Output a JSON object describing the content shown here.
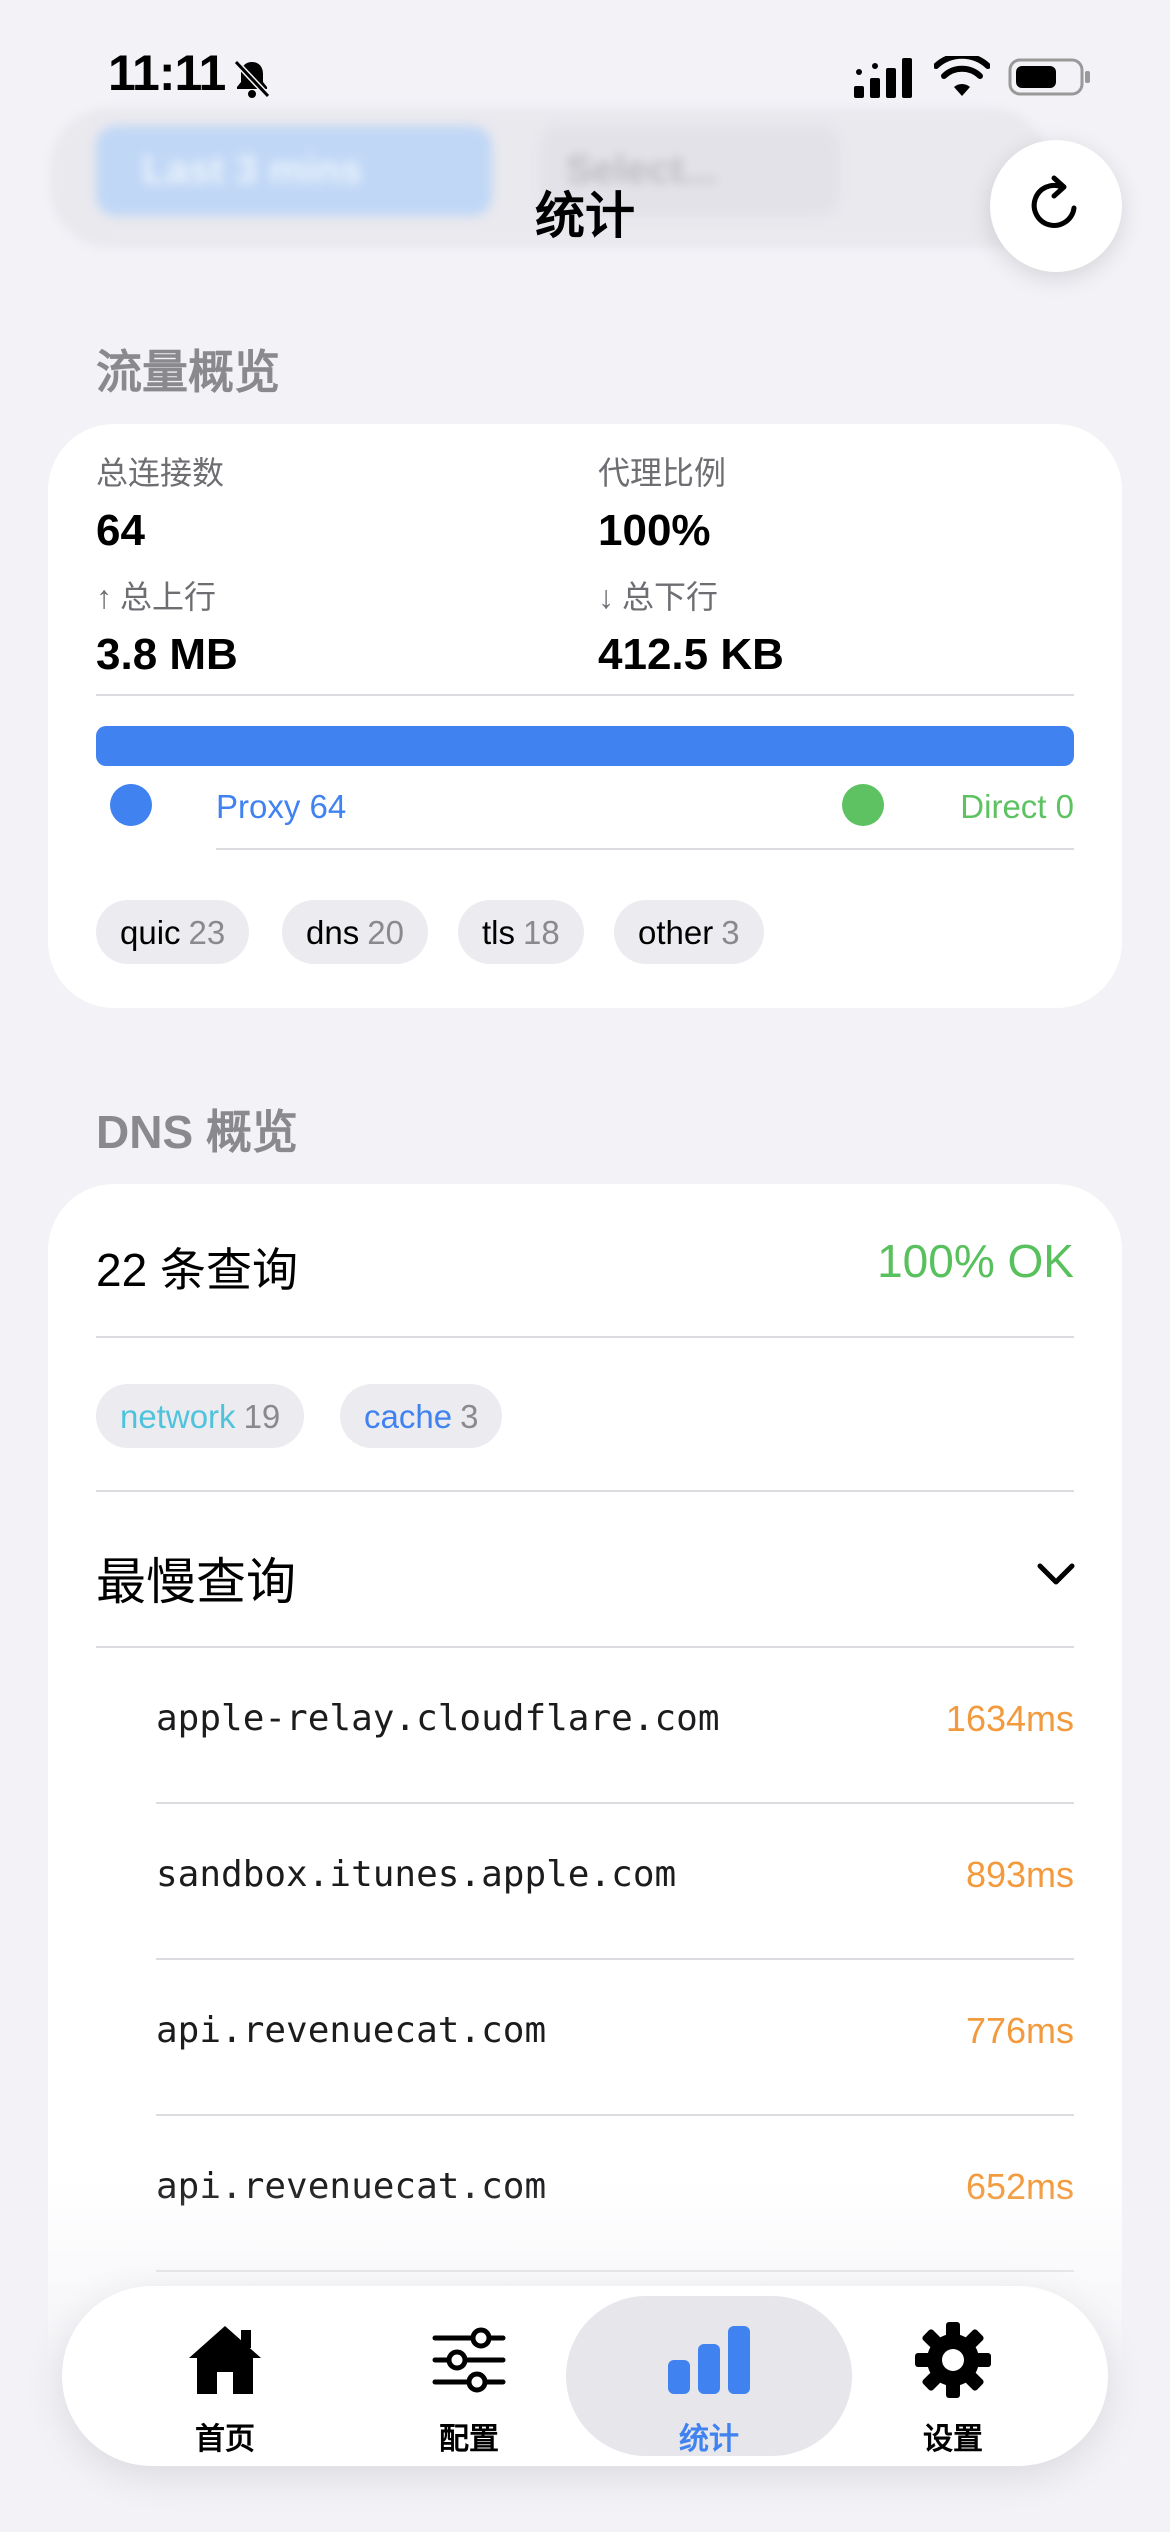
{
  "status_bar": {
    "time": "11:11"
  },
  "header": {
    "title": "统计",
    "time_filter": "Last 3 mins",
    "select_placeholder": "Select..."
  },
  "traffic": {
    "section_title": "流量概览",
    "total_connections_label": "总连接数",
    "total_connections": "64",
    "proxy_ratio_label": "代理比例",
    "proxy_ratio": "100%",
    "upload_label": "总上行",
    "upload": "3.8 MB",
    "download_label": "总下行",
    "download": "412.5 KB",
    "ratio_fraction": 1.0,
    "proxy_legend": "Proxy 64",
    "direct_legend": "Direct 0",
    "protocols": [
      {
        "name": "quic",
        "count": "23"
      },
      {
        "name": "dns",
        "count": "20"
      },
      {
        "name": "tls",
        "count": "18"
      },
      {
        "name": "other",
        "count": "3"
      }
    ],
    "colors": {
      "proxy": "#3f82f0",
      "direct": "#5ec262"
    }
  },
  "dns": {
    "section_title": "DNS 概览",
    "queries": "22 条查询",
    "ok": "100% OK",
    "sources": [
      {
        "name": "network",
        "count": "19",
        "color": "#4fc3dc"
      },
      {
        "name": "cache",
        "count": "3",
        "color": "#3f82f0"
      }
    ],
    "slowest_title": "最慢查询",
    "slowest": [
      {
        "domain": "apple-relay.cloudflare.com",
        "ms": "1634ms"
      },
      {
        "domain": "sandbox.itunes.apple.com",
        "ms": "893ms"
      },
      {
        "domain": "api.revenuecat.com",
        "ms": "776ms"
      },
      {
        "domain": "api.revenuecat.com",
        "ms": "652ms"
      }
    ]
  },
  "tabs": [
    {
      "label": "首页",
      "icon": "house-icon"
    },
    {
      "label": "配置",
      "icon": "sliders-icon"
    },
    {
      "label": "统计",
      "icon": "bar-chart-icon",
      "active": true
    },
    {
      "label": "设置",
      "icon": "gear-icon"
    }
  ]
}
